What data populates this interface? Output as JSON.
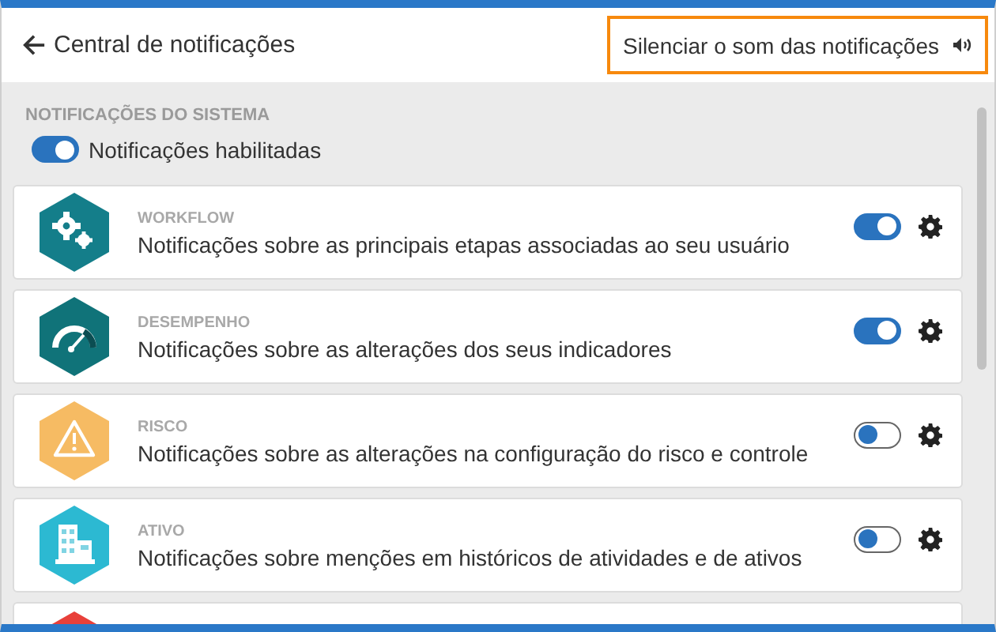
{
  "header": {
    "title": "Central de notificações",
    "mute_button": "Silenciar o som das notificações"
  },
  "system": {
    "label": "NOTIFICAÇÕES DO SISTEMA",
    "toggle_label": "Notificações habilitadas",
    "on": true
  },
  "categories": [
    {
      "kind": "gears",
      "color": "#147e8a",
      "label": "WORKFLOW",
      "description": "Notificações sobre as principais etapas associadas ao seu usuário",
      "on": true
    },
    {
      "kind": "gauge",
      "color": "#107379",
      "label": "DESEMPENHO",
      "description": "Notificações sobre as alterações dos seus indicadores",
      "on": true
    },
    {
      "kind": "warning",
      "color": "#f6bb63",
      "label": "RISCO",
      "description": "Notificações sobre as alterações na configuração do risco e controle",
      "on": false
    },
    {
      "kind": "building",
      "color": "#2cb9d2",
      "label": "ATIVO",
      "description": "Notificações sobre menções em históricos de atividades e de ativos",
      "on": false
    },
    {
      "color": "#e8403a"
    }
  ]
}
